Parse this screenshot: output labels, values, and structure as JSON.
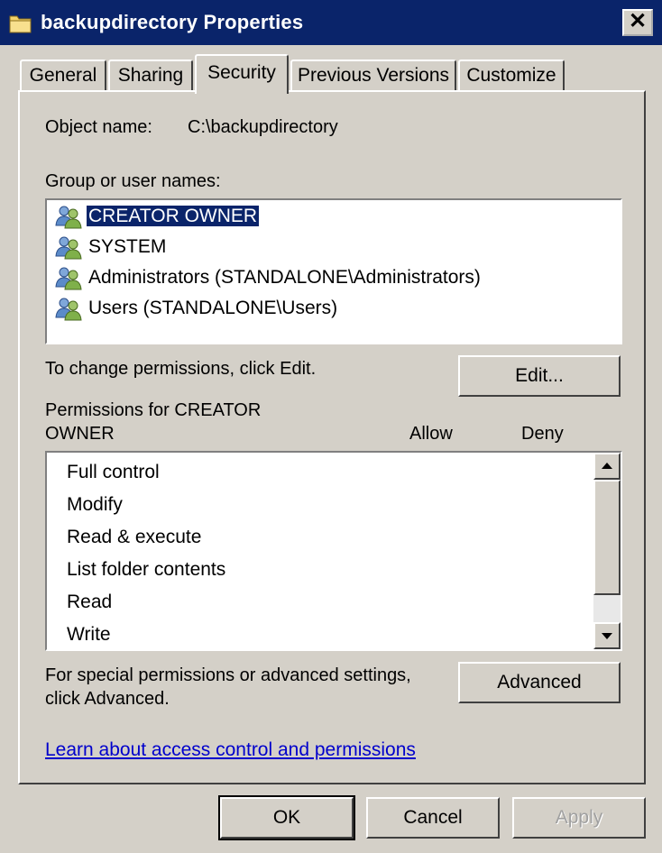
{
  "window": {
    "title": "backupdirectory Properties",
    "close_label": "✕"
  },
  "tabs": [
    {
      "label": "General"
    },
    {
      "label": "Sharing"
    },
    {
      "label": "Security",
      "active": true
    },
    {
      "label": "Previous Versions"
    },
    {
      "label": "Customize"
    }
  ],
  "security": {
    "object_name_label": "Object name:",
    "object_name_value": "C:\\backupdirectory",
    "group_label": "Group or user names:",
    "users": [
      {
        "name": "CREATOR OWNER",
        "selected": true,
        "icon": "user-group-icon"
      },
      {
        "name": "SYSTEM",
        "icon": "user-group-icon"
      },
      {
        "name": "Administrators (STANDALONE\\Administrators)",
        "icon": "user-group-icon"
      },
      {
        "name": "Users (STANDALONE\\Users)",
        "icon": "user-group-icon"
      }
    ],
    "change_hint": "To change permissions, click Edit.",
    "edit_button": "Edit...",
    "permissions_for_line1": "Permissions for CREATOR",
    "permissions_for_line2": "OWNER",
    "allow_header": "Allow",
    "deny_header": "Deny",
    "permissions": [
      {
        "name": "Full control"
      },
      {
        "name": "Modify"
      },
      {
        "name": "Read & execute"
      },
      {
        "name": "List folder contents"
      },
      {
        "name": "Read"
      },
      {
        "name": "Write"
      }
    ],
    "special_hint_line1": "For special permissions or advanced settings,",
    "special_hint_line2": "click Advanced.",
    "advanced_button": "Advanced",
    "learn_link": "Learn about access control and permissions"
  },
  "footer": {
    "ok": "OK",
    "cancel": "Cancel",
    "apply": "Apply"
  },
  "colors": {
    "titlebar": "#0a246a",
    "selection": "#0a246a",
    "link": "#0000cc",
    "face": "#d4d0c8"
  }
}
